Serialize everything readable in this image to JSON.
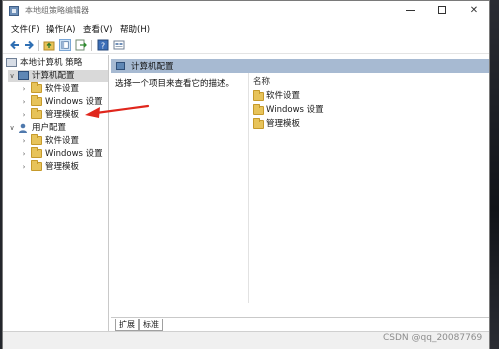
{
  "window": {
    "title": "本地组策略编辑器"
  },
  "menubar": {
    "items": [
      "文件(F)",
      "操作(A)",
      "查看(V)",
      "帮助(H)"
    ]
  },
  "toolbar": {
    "buttons": [
      "back-icon",
      "forward-icon",
      "up-folder-icon",
      "show-hide-tree-icon",
      "export-list-icon",
      "help-icon",
      "properties-icon"
    ]
  },
  "tree": {
    "root": "本地计算机 策略",
    "computer_config": "计算机配置",
    "computer_children": [
      "软件设置",
      "Windows 设置",
      "管理模板"
    ],
    "user_config": "用户配置",
    "user_children": [
      "软件设置",
      "Windows 设置",
      "管理模板"
    ]
  },
  "main": {
    "header": "计算机配置",
    "description": "选择一个项目来查看它的描述。",
    "column_name": "名称",
    "items": [
      "软件设置",
      "Windows 设置",
      "管理模板"
    ]
  },
  "tabs": [
    "扩展",
    "标准"
  ],
  "watermark": "CSDN @qq_20087769",
  "colors": {
    "header_bar": "#a7bad2",
    "arrow": "#e0261c",
    "folder": "#e7c35a"
  }
}
